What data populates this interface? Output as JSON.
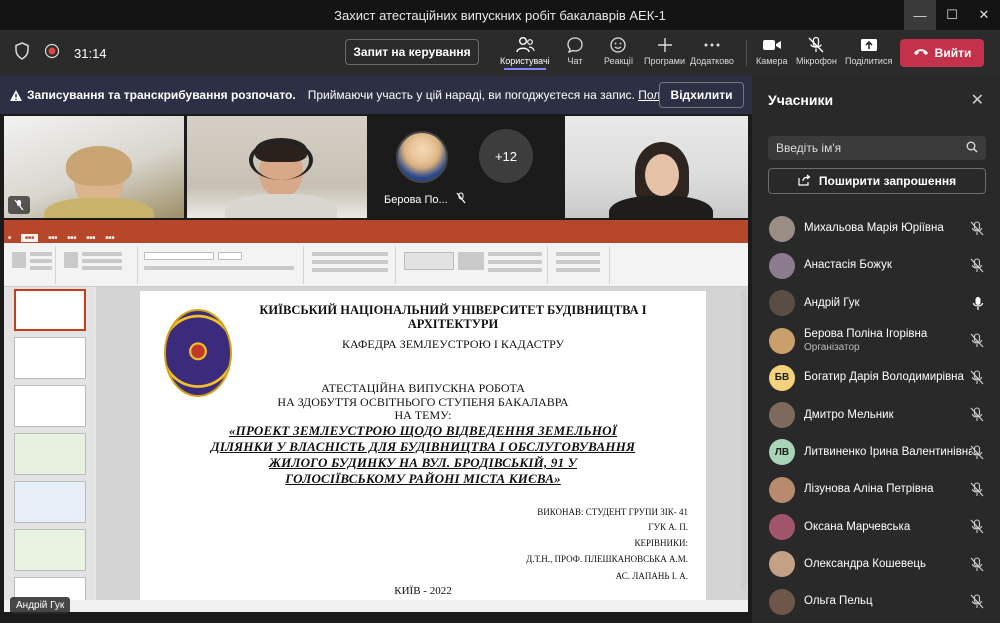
{
  "window": {
    "title": "Захист атестаційних випускних робіт бакалаврів АЕК-1"
  },
  "toolbar": {
    "timer": "31:14",
    "request_control": "Запит на керування",
    "items": [
      {
        "label": "Користувачі",
        "icon": "people-icon"
      },
      {
        "label": "Чат",
        "icon": "chat-icon"
      },
      {
        "label": "Реакції",
        "icon": "reaction-icon"
      },
      {
        "label": "Програми",
        "icon": "plus-icon"
      },
      {
        "label": "Додатково",
        "icon": "more-icon"
      },
      {
        "label": "Камера",
        "icon": "camera-icon"
      },
      {
        "label": "Мікрофон",
        "icon": "mic-off-icon"
      },
      {
        "label": "Поділитися",
        "icon": "share-icon"
      }
    ],
    "leave": "Вийти"
  },
  "banner": {
    "bold": "Записування та транскрибування розпочато.",
    "text": "Приймаючи участь у цій нараді, ви погоджуєтеся на запис.",
    "link": "Політика ко...",
    "dismiss": "Відхилити"
  },
  "stage": {
    "tile_name": "Берова По...",
    "more_count": "+12",
    "presenter_tag": "Андрій Гук"
  },
  "slide": {
    "line1": "КИЇВСЬКИЙ НАЦІОНАЛЬНИЙ УНІВЕРСИТЕТ БУДІВНИЦТВА І",
    "line2": "АРХІТЕКТУРИ",
    "line3": "КАФЕДРА ЗЕМЛЕУСТРОЮ І КАДАСТРУ",
    "line4": "АТЕСТАЦІЙНА ВИПУСКНА РОБОТА",
    "line5": "НА ЗДОБУТТЯ ОСВІТНЬОГО СТУПЕНЯ БАКАЛАВРА",
    "line6": "НА ТЕМУ:",
    "topic1": "«ПРОЕКТ ЗЕМЛЕУСТРОЮ ЩОДО ВІДВЕДЕННЯ ЗЕМЕЛЬНОЇ",
    "topic2": "ДІЛЯНКИ У ВЛАСНІСТЬ ДЛЯ БУДІВНИЦТВА І ОБСЛУГОВУВАННЯ",
    "topic3": "ЖИЛОГО БУДИНКУ НА ВУЛ. БРОДІВСЬКІЙ, 91 У",
    "topic4": "ГОЛОСІЇВСЬКОМУ РАЙОНІ МІСТА КИЄВА»",
    "r1": "ВИКОНАВ: СТУДЕНТ ГРУПИ ЗІК- 41",
    "r2": "ГУК А. П.",
    "r3": "КЕРІВНИКИ:",
    "r4": "Д.Т.Н., ПРОФ. ПЛЕШКАНОВСЬКА  А.М.",
    "r5": "АС. ЛАПАНЬ І. А.",
    "footer": "КИЇВ - 2022"
  },
  "panel": {
    "title": "Учасники",
    "search_placeholder": "Введіть ім'я",
    "invite": "Поширити запрошення",
    "participants": [
      {
        "name": "Михальова Марія Юріївна",
        "role": "",
        "initials": "",
        "color": "#9a8d86",
        "mic": "off"
      },
      {
        "name": "Анастасія Божук",
        "role": "",
        "initials": "",
        "color": "#8c7a8f",
        "mic": "off"
      },
      {
        "name": "Андрій Гук",
        "role": "",
        "initials": "",
        "color": "#5a4d44",
        "mic": "on"
      },
      {
        "name": "Берова Поліна Ігорівна",
        "role": "Організатор",
        "initials": "",
        "color": "#c9a06c",
        "mic": "off"
      },
      {
        "name": "Богатир Дарія Володимирівна",
        "role": "",
        "initials": "БВ",
        "color": "#f2d37b",
        "mic": "off"
      },
      {
        "name": "Дмитро Мельник",
        "role": "",
        "initials": "",
        "color": "#7d6a5c",
        "mic": "off"
      },
      {
        "name": "Литвиненко Ірина Валентинівна",
        "role": "",
        "initials": "ЛВ",
        "color": "#a8d5b8",
        "mic": "off"
      },
      {
        "name": "Лізунова Аліна Петрівна",
        "role": "",
        "initials": "",
        "color": "#b88b6e",
        "mic": "off"
      },
      {
        "name": "Оксана Марчевська",
        "role": "",
        "initials": "",
        "color": "#a0556a",
        "mic": "off"
      },
      {
        "name": "Олександра Кошевець",
        "role": "",
        "initials": "",
        "color": "#c4a184",
        "mic": "off"
      },
      {
        "name": "Ольга Пельц",
        "role": "",
        "initials": "",
        "color": "#6e5648",
        "mic": "off"
      }
    ]
  }
}
